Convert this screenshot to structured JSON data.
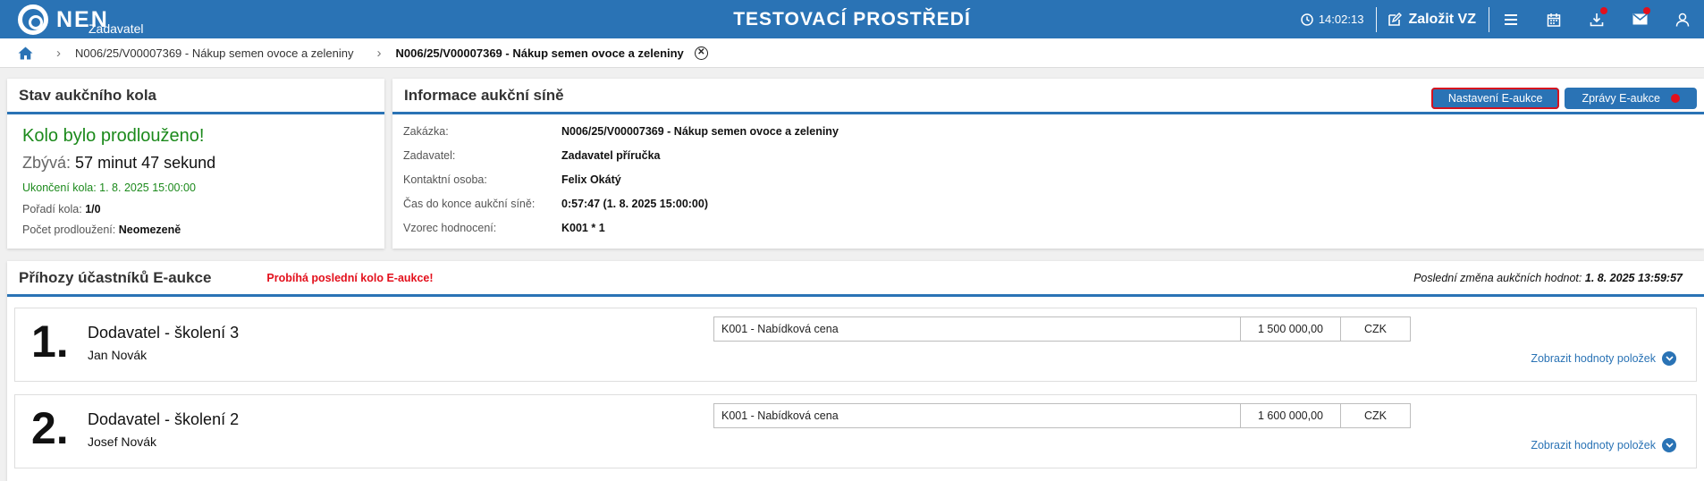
{
  "topbar": {
    "logo_text": "NEN",
    "logo_sub": "Zadavatel",
    "env_title": "TESTOVACÍ PROSTŘEDÍ",
    "clock": "14:02:13",
    "zalozit_label": "Založit VZ",
    "colors": {
      "bar": "#2a73b5",
      "notify": "#e3101c"
    }
  },
  "breadcrumb": {
    "item1": "N006/25/V00007369 - Nákup semen ovoce a zeleniny",
    "item2": "N006/25/V00007369 - Nákup semen ovoce a zeleniny",
    "close_glyph": "✕"
  },
  "stav": {
    "title": "Stav aukčního kola",
    "status": "Kolo bylo prodlouženo!",
    "zbyva_label": "Zbývá:",
    "zbyva_value": "57 minut 47 sekund",
    "ukonceni": "Ukončení kola: 1. 8. 2025 15:00:00",
    "poradi_label": "Pořadí kola:",
    "poradi_value": "1/0",
    "pocet_label": "Počet prodloužení:",
    "pocet_value": "Neomezeně"
  },
  "info": {
    "title": "Informace aukční síně",
    "btn_nastaveni": "Nastavení E-aukce",
    "btn_zpravy": "Zprávy E-aukce",
    "rows": [
      {
        "k": "Zakázka:",
        "v": "N006/25/V00007369 - Nákup semen ovoce a zeleniny"
      },
      {
        "k": "Zadavatel:",
        "v": "Zadavatel příručka"
      },
      {
        "k": "Kontaktní osoba:",
        "v": "Felix Okátý"
      },
      {
        "k": "Čas do konce aukční síně:",
        "v": "0:57:47 (1. 8. 2025 15:00:00)"
      },
      {
        "k": "Vzorec hodnocení:",
        "v": "K001 * 1"
      }
    ]
  },
  "prihozy": {
    "title": "Příhozy účastníků E-aukce",
    "warning": "Probíhá poslední kolo E-aukce!",
    "last_change_label": "Poslední změna aukčních hodnot:",
    "last_change_value": "1. 8. 2025 13:59:57",
    "bids": [
      {
        "rank": "1.",
        "supplier": "Dodavatel - školení 3",
        "person": "Jan Novák",
        "criterion": "K001 - Nabídková cena",
        "value": "1 500 000,00",
        "currency": "CZK",
        "show_label": "Zobrazit hodnoty položek"
      },
      {
        "rank": "2.",
        "supplier": "Dodavatel - školení 2",
        "person": "Josef Novák",
        "criterion": "K001 - Nabídková cena",
        "value": "1 600 000,00",
        "currency": "CZK",
        "show_label": "Zobrazit hodnoty položek"
      }
    ]
  }
}
